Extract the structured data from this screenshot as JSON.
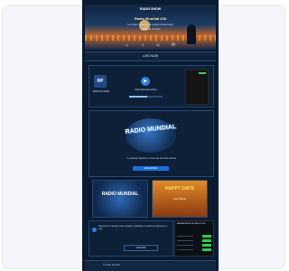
{
  "banner": {
    "line1": "RADIO SHOW",
    "line2": "Radio Mundial 24h",
    "line3": "La mejor música de todos los tiempos",
    "line4": "Escucha en vivo",
    "icons": [
      "home-icon",
      "music-icon",
      "person-icon",
      "mail-icon"
    ]
  },
  "tabbar": {
    "label": "LIVE NOW"
  },
  "player": {
    "logo_text": "RP",
    "station": "RADIO PLAYER",
    "now_playing": "Reproduciendo ahora",
    "progress": 0.55
  },
  "hero": {
    "title": "RADIO MUNDIAL",
    "caption": "Tu estación favorita en línea, las 24 horas del día",
    "button": "ESCUCHAR"
  },
  "thumbs": {
    "left_title": "RADIO MUNDIAL",
    "right_title": "HAPPY DAYS",
    "right_sub": "Live Show"
  },
  "lower": {
    "text": "Síguenos en nuestras redes sociales y participa en nuestros programas en vivo.",
    "button": "VER MÁS"
  },
  "stats": {
    "heading": "Estadísticas de la radio en vivo",
    "rows": 5
  },
  "footer": {
    "text": "© Radio Mundial"
  },
  "colors": {
    "accent": "#2f7fe0",
    "page_bg": "#0a1a30",
    "status_green": "#33c64f"
  }
}
